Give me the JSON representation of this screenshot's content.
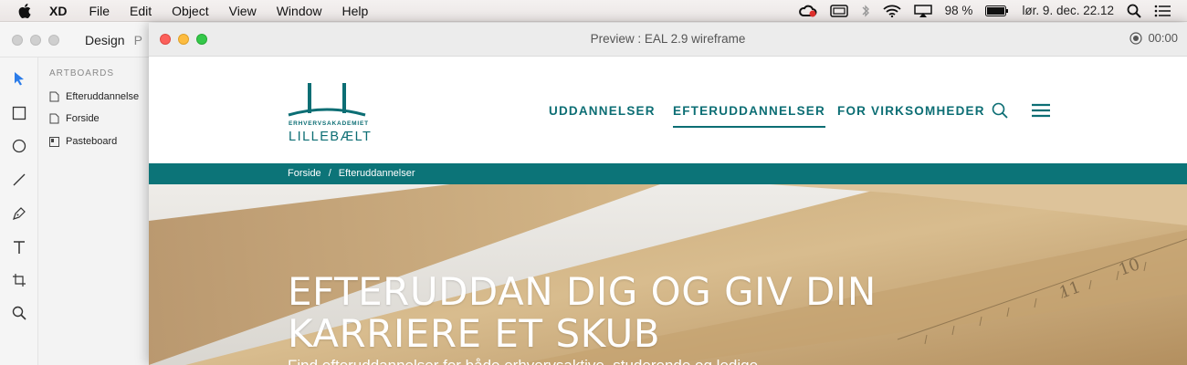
{
  "menubar": {
    "app_name": "XD",
    "items": [
      "File",
      "Edit",
      "Object",
      "View",
      "Window",
      "Help"
    ],
    "battery": "98 %",
    "datetime": "lør. 9. dec.  22.12"
  },
  "xd": {
    "tabs": {
      "design": "Design",
      "prototype_partial": "P"
    },
    "artboards_heading": "ARTBOARDS",
    "artboards": [
      "Efteruddannelse",
      "Forside",
      "Pasteboard"
    ]
  },
  "preview": {
    "title": "Preview : EAL 2.9 wireframe",
    "timer": "00:00"
  },
  "site": {
    "logo_small": "ERHVERVSAKADEMIET",
    "logo_big": "LILLEBÆLT",
    "nav": [
      "UDDANNELSER",
      "EFTERUDDANNELSER",
      "FOR VIRKSOMHEDER"
    ],
    "breadcrumb": [
      "Forside",
      "/",
      "Efteruddannelser"
    ],
    "hero_title_line1": "EFTERUDDAN DIG OG GIV DIN",
    "hero_title_line2": "KARRIERE ET SKUB",
    "hero_subtitle": "Find efteruddannelser for både erhvervsaktive, studerende og ledige",
    "accent": "#0c6e74"
  }
}
